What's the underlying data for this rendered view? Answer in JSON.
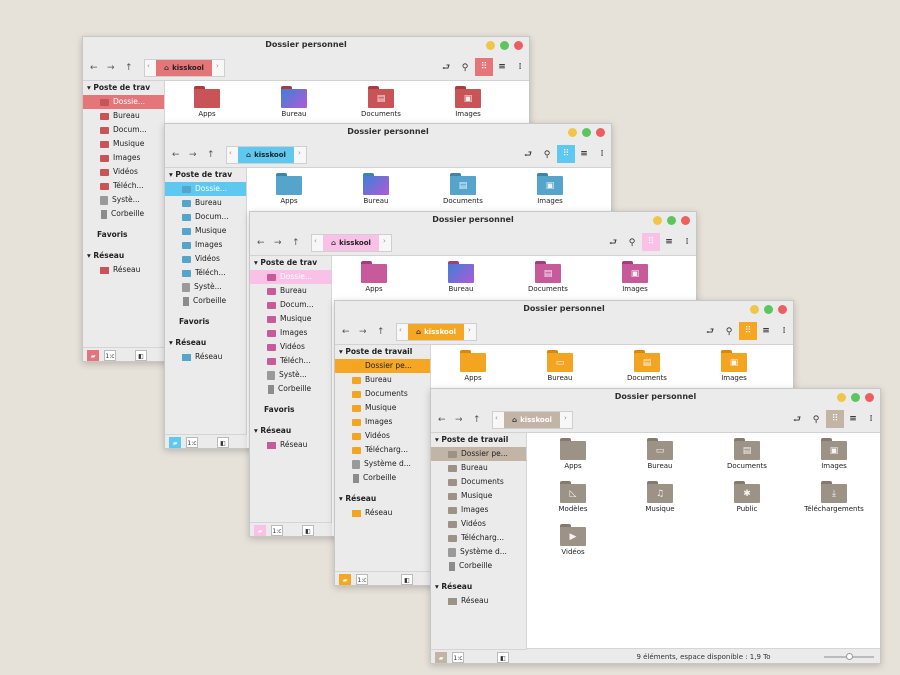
{
  "windows": [
    {
      "title": "Dossier personnel",
      "path": "kisskool",
      "accent": "#e4767a",
      "folder": "#c95458",
      "folder_tab": "#a93c40",
      "sel_text": "#ffffff",
      "compact": true,
      "places_header": "Poste de trav",
      "places": [
        {
          "label": "Dossie...",
          "icon": "folder"
        },
        {
          "label": "Bureau",
          "icon": "folder"
        },
        {
          "label": "Docum...",
          "icon": "folder"
        },
        {
          "label": "Musique",
          "icon": "folder"
        },
        {
          "label": "Images",
          "icon": "folder"
        },
        {
          "label": "Vidéos",
          "icon": "folder"
        },
        {
          "label": "Téléch...",
          "icon": "folder"
        },
        {
          "label": "Systè...",
          "icon": "disk"
        },
        {
          "label": "Corbeille",
          "icon": "trash"
        }
      ],
      "favorites_header": "Favoris",
      "network_header": "Réseau",
      "network": [
        {
          "label": "Réseau",
          "icon": "folder"
        }
      ],
      "files": [
        {
          "label": "Apps",
          "glyph": ""
        },
        {
          "label": "Bureau",
          "glyph": ""
        },
        {
          "label": "Documents",
          "glyph": "▤"
        },
        {
          "label": "Images",
          "glyph": "▣"
        }
      ]
    },
    {
      "title": "Dossier personnel",
      "path": "kisskool",
      "accent": "#5ec8f1",
      "folder": "#54a4cc",
      "folder_tab": "#3c84aa",
      "sel_text": "#ffffff",
      "compact": true,
      "places_header": "Poste de trav",
      "places": [
        {
          "label": "Dossie...",
          "icon": "folder"
        },
        {
          "label": "Bureau",
          "icon": "folder"
        },
        {
          "label": "Docum...",
          "icon": "folder"
        },
        {
          "label": "Musique",
          "icon": "folder"
        },
        {
          "label": "Images",
          "icon": "folder"
        },
        {
          "label": "Vidéos",
          "icon": "folder"
        },
        {
          "label": "Téléch...",
          "icon": "folder"
        },
        {
          "label": "Systè...",
          "icon": "disk"
        },
        {
          "label": "Corbeille",
          "icon": "trash"
        }
      ],
      "favorites_header": "Favoris",
      "network_header": "Réseau",
      "network": [
        {
          "label": "Réseau",
          "icon": "folder"
        }
      ],
      "files": [
        {
          "label": "Apps",
          "glyph": ""
        },
        {
          "label": "Bureau",
          "glyph": ""
        },
        {
          "label": "Documents",
          "glyph": "▤"
        },
        {
          "label": "Images",
          "glyph": "▣"
        }
      ]
    },
    {
      "title": "Dossier personnel",
      "path": "kisskool",
      "accent": "#f9c1e6",
      "folder": "#c65a9a",
      "folder_tab": "#a33e7c",
      "sel_text": "#ffffff",
      "compact": true,
      "places_header": "Poste de trav",
      "places": [
        {
          "label": "Dossie...",
          "icon": "folder"
        },
        {
          "label": "Bureau",
          "icon": "folder"
        },
        {
          "label": "Docum...",
          "icon": "folder"
        },
        {
          "label": "Musique",
          "icon": "folder"
        },
        {
          "label": "Images",
          "icon": "folder"
        },
        {
          "label": "Vidéos",
          "icon": "folder"
        },
        {
          "label": "Téléch...",
          "icon": "folder"
        },
        {
          "label": "Systè...",
          "icon": "disk"
        },
        {
          "label": "Corbeille",
          "icon": "trash"
        }
      ],
      "favorites_header": "Favoris",
      "network_header": "Réseau",
      "network": [
        {
          "label": "Réseau",
          "icon": "folder"
        }
      ],
      "files": [
        {
          "label": "Apps",
          "glyph": ""
        },
        {
          "label": "Bureau",
          "glyph": ""
        },
        {
          "label": "Documents",
          "glyph": "▤"
        },
        {
          "label": "Images",
          "glyph": "▣"
        }
      ]
    },
    {
      "title": "Dossier personnel",
      "path": "kisskool",
      "accent": "#f5a623",
      "folder": "#f3a421",
      "folder_tab": "#d68810",
      "sel_text": "#222222",
      "compact": false,
      "places_header": "Poste de travail",
      "places": [
        {
          "label": "Dossier pe...",
          "icon": "folder"
        },
        {
          "label": "Bureau",
          "icon": "folder"
        },
        {
          "label": "Documents",
          "icon": "folder"
        },
        {
          "label": "Musique",
          "icon": "folder"
        },
        {
          "label": "Images",
          "icon": "folder"
        },
        {
          "label": "Vidéos",
          "icon": "folder"
        },
        {
          "label": "Télécharg...",
          "icon": "folder"
        },
        {
          "label": "Système d...",
          "icon": "disk"
        },
        {
          "label": "Corbeille",
          "icon": "trash"
        }
      ],
      "favorites_header": "",
      "network_header": "Réseau",
      "network": [
        {
          "label": "Réseau",
          "icon": "folder"
        }
      ],
      "files": [
        {
          "label": "Apps",
          "glyph": ""
        },
        {
          "label": "Bureau",
          "glyph": "▭"
        },
        {
          "label": "Documents",
          "glyph": "▤"
        },
        {
          "label": "Images",
          "glyph": "▣"
        }
      ]
    },
    {
      "title": "Dossier personnel",
      "path": "kisskool",
      "accent": "#c3b5a6",
      "folder": "#9d9286",
      "folder_tab": "#857a6f",
      "sel_text": "#222222",
      "compact": false,
      "places_header": "Poste de travail",
      "places": [
        {
          "label": "Dossier pe...",
          "icon": "folder"
        },
        {
          "label": "Bureau",
          "icon": "folder"
        },
        {
          "label": "Documents",
          "icon": "folder"
        },
        {
          "label": "Musique",
          "icon": "folder"
        },
        {
          "label": "Images",
          "icon": "folder"
        },
        {
          "label": "Vidéos",
          "icon": "folder"
        },
        {
          "label": "Télécharg...",
          "icon": "folder"
        },
        {
          "label": "Système d...",
          "icon": "disk"
        },
        {
          "label": "Corbeille",
          "icon": "trash"
        }
      ],
      "favorites_header": "",
      "network_header": "Réseau",
      "network": [
        {
          "label": "Réseau",
          "icon": "folder"
        }
      ],
      "files": [
        {
          "label": "Apps",
          "glyph": ""
        },
        {
          "label": "Bureau",
          "glyph": "▭"
        },
        {
          "label": "Documents",
          "glyph": "▤"
        },
        {
          "label": "Images",
          "glyph": "▣"
        },
        {
          "label": "Modèles",
          "glyph": "◺"
        },
        {
          "label": "Musique",
          "glyph": "♫"
        },
        {
          "label": "Public",
          "glyph": "✱"
        },
        {
          "label": "Téléchargements",
          "glyph": "⤓"
        },
        {
          "label": "Vidéos",
          "glyph": "▶"
        }
      ],
      "status": "9 éléments, espace disponible : 1,9 To"
    }
  ],
  "toolbar": {
    "back": "←",
    "forward": "→",
    "up": "↑",
    "terminal": "⮐",
    "search": "⚲",
    "grid_view": "⠿",
    "list_view": "≡",
    "compact_view": "⁞",
    "path_left": "‹",
    "path_right": "›"
  },
  "bottom_buttons": {
    "places": "▰",
    "tree": "1:c",
    "hide": "◧"
  }
}
